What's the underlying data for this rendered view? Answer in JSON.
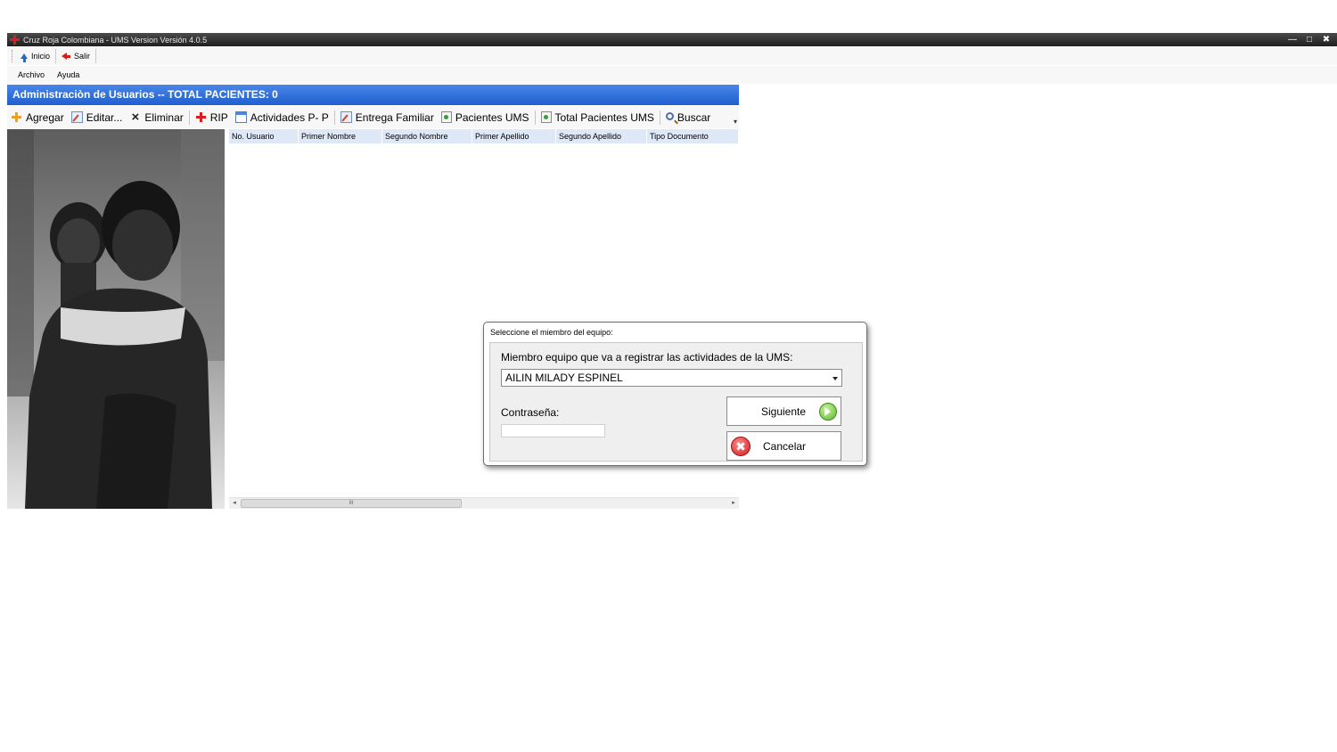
{
  "window": {
    "title": "Cruz Roja Colombiana - UMS Version Versión 4.0.5",
    "controls": [
      "—",
      "□",
      "✖"
    ]
  },
  "quickbar": {
    "home_label": "Inicio",
    "exit_label": "Salir"
  },
  "menu": {
    "file": "Archivo",
    "help": "Ayuda"
  },
  "header": {
    "title": "Administraciòn de Usuarios -- TOTAL PACIENTES: 0"
  },
  "toolbar": {
    "add": "Agregar",
    "edit": "Editar...",
    "delete": "Eliminar",
    "rip": "RIP",
    "activities": "Actividades P- P",
    "family": "Entrega Familiar",
    "patients": "Pacientes UMS",
    "total": "Total Pacientes UMS",
    "search": "Buscar"
  },
  "grid": {
    "columns": [
      "No. Usuario",
      "Primer Nombre",
      "Segundo Nombre",
      "Primer Apellido",
      "Segundo Apellido",
      "Tipo Documento"
    ],
    "scroll_grip": "III"
  },
  "dialog": {
    "title": "Seleccione el miembro del equipo:",
    "member_label": "Miembro equipo que va a registrar las actividades de la UMS:",
    "member_value": "AILIN MILADY  ESPINEL",
    "password_label": "Contraseña:",
    "password_value": "",
    "next_label": "Siguiente",
    "cancel_label": "Cancelar",
    "cancel_glyph": "✖"
  },
  "colors": {
    "header_blue": "#1f5fcf",
    "titlebar": "#2b2b2b",
    "cross_red": "#d81e1e"
  }
}
